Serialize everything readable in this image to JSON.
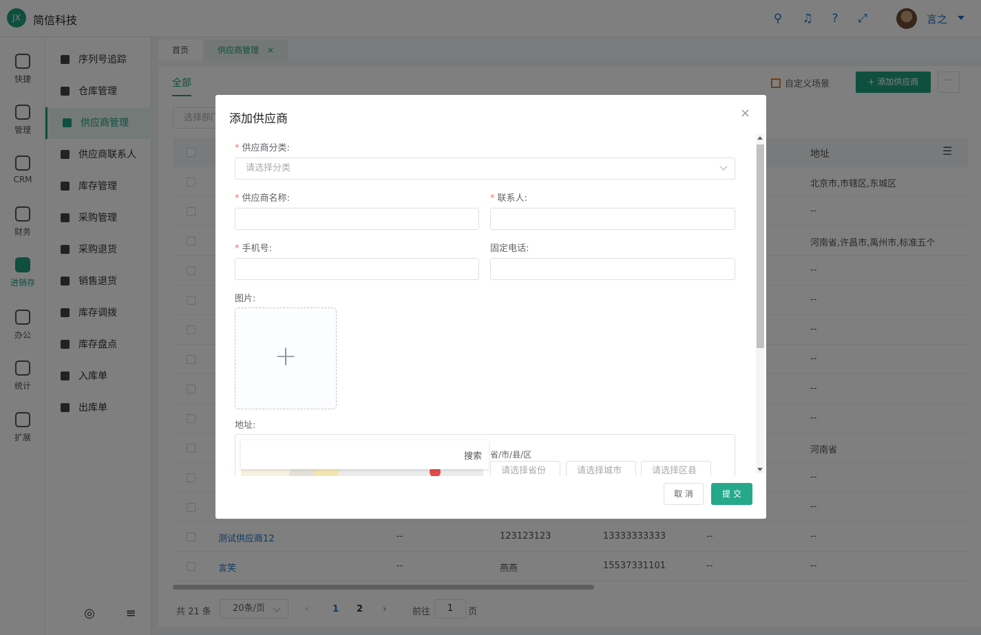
{
  "header": {
    "logo_badge": "JX",
    "app_name": "简信科技",
    "user_name": "言之",
    "icons": [
      "search-icon",
      "bell-icon",
      "help-icon",
      "fullscreen-icon"
    ],
    "accent": "#1f6fc5",
    "brand": "#1f9e7c"
  },
  "left_nav": [
    {
      "label": "快捷",
      "icon": "home-icon"
    },
    {
      "label": "管理",
      "icon": "user-manage-icon"
    },
    {
      "label": "CRM",
      "icon": "crm-icon"
    },
    {
      "label": "财务",
      "icon": "finance-icon"
    },
    {
      "label": "进销存",
      "icon": "inventory-icon",
      "active": true
    },
    {
      "label": "办公",
      "icon": "monitor-icon"
    },
    {
      "label": "统计",
      "icon": "stats-icon"
    },
    {
      "label": "扩展",
      "icon": "extend-icon"
    }
  ],
  "sub_nav": [
    {
      "label": "序列号追踪"
    },
    {
      "label": "仓库管理"
    },
    {
      "label": "供应商管理",
      "active": true
    },
    {
      "label": "供应商联系人"
    },
    {
      "label": "库存管理"
    },
    {
      "label": "采购管理"
    },
    {
      "label": "采购退货"
    },
    {
      "label": "销售退货"
    },
    {
      "label": "库存调拨"
    },
    {
      "label": "库存盘点"
    },
    {
      "label": "入库单"
    },
    {
      "label": "出库单"
    }
  ],
  "tabs": [
    {
      "label": "首页"
    },
    {
      "label": "供应商管理",
      "active": true,
      "close": "×"
    }
  ],
  "toolbar": {
    "sub_tab": "全部",
    "custom_scene": "自定义场景",
    "add_button": "+ 添加供应商",
    "more": "···",
    "filter_placeholder": "选择部门"
  },
  "table": {
    "address_header": "地址",
    "addresses": [
      "北京市,市辖区,东城区",
      "--",
      "河南省,许昌市,禹州市,标准五个",
      "--",
      "--",
      "--",
      "--",
      "--",
      "--",
      "河南省",
      "--",
      "--"
    ],
    "bottom_rows": [
      {
        "name": "测试供应商12",
        "col2": "--",
        "col3": "123123123",
        "col4": "13333333333",
        "col5": "--",
        "col6": "--"
      },
      {
        "name": "言笑",
        "col2": "--",
        "col3": "燕燕",
        "col4": "15537331101",
        "col5": "--",
        "col6": "--"
      }
    ]
  },
  "pager": {
    "total": "共 21 条",
    "size": "20条/页",
    "prev": "‹",
    "pages": [
      "1",
      "2"
    ],
    "next": "›",
    "goto": "前往",
    "goto_value": "1",
    "page_suffix": "页"
  },
  "dialog": {
    "title": "添加供应商",
    "close": "×",
    "category_label": "供应商分类:",
    "category_placeholder": "请选择分类",
    "name_label": "供应商名称:",
    "contact_label": "联系人:",
    "mobile_label": "手机号:",
    "phone_label": "固定电话:",
    "image_label": "图片:",
    "upload_plus": "+",
    "address_label": "地址:",
    "map_search": "搜索",
    "region_label": "省/市/县/区",
    "province_placeholder": "请选择省份",
    "city_placeholder": "请选择城市",
    "district_placeholder": "请选择区县",
    "required_mark": "*",
    "cancel": "取 消",
    "submit": "提 交"
  }
}
